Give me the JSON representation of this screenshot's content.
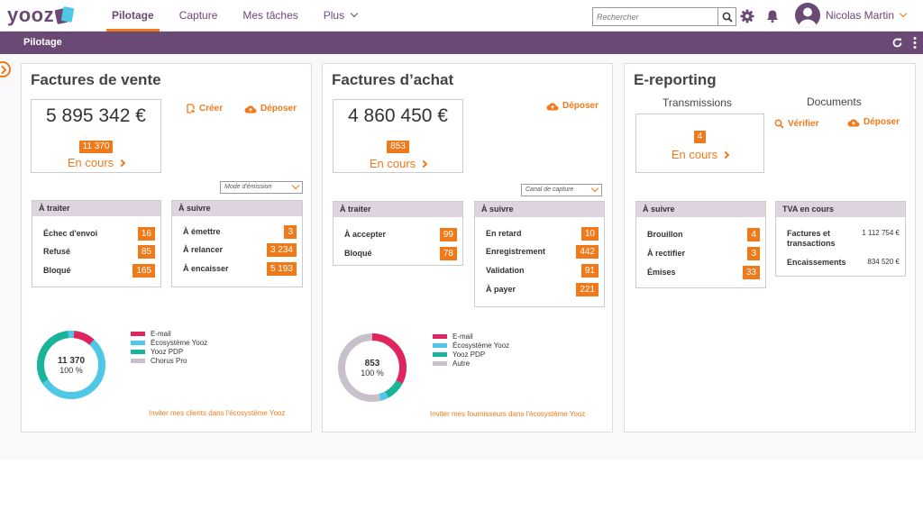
{
  "app": {
    "logo": "yooz"
  },
  "nav": {
    "items": [
      {
        "label": "Pilotage"
      },
      {
        "label": "Capture"
      },
      {
        "label": "Mes tâches"
      },
      {
        "label": "Plus"
      }
    ]
  },
  "search": {
    "placeholder": "Rechercher"
  },
  "user": {
    "name": "Nicolas Martin"
  },
  "subbar": {
    "title": "Pilotage"
  },
  "colors": {
    "brand": "#6a4a74",
    "accent": "#f07a1a",
    "email": "#e0245e",
    "ecosystem": "#4fc8e8",
    "pdp": "#18b59a",
    "other": "#c8c0ca"
  },
  "vente": {
    "title": "Factures de vente",
    "amount": "5 895 342 €",
    "count": "11 370",
    "link": "En cours",
    "create": "Créer",
    "deposit": "Déposer",
    "select": "Mode d'émission",
    "traiter": {
      "title": "À traiter",
      "rows": [
        {
          "label": "Échec d'envoi",
          "value": "16"
        },
        {
          "label": "Refusé",
          "value": "85"
        },
        {
          "label": "Bloqué",
          "value": "165"
        }
      ]
    },
    "suivre": {
      "title": "À suivre",
      "rows": [
        {
          "label": "À émettre",
          "value": "3"
        },
        {
          "label": "À relancer",
          "value": "3 234"
        },
        {
          "label": "À encaisser",
          "value": "5 193"
        }
      ]
    },
    "donut": {
      "total": "11 370",
      "percent": "100 %"
    },
    "legend": [
      "E-mail",
      "Écosystème Yooz",
      "Yooz PDP",
      "Chorus Pro"
    ],
    "invite": "Inviter mes clients dans l'écosystème Yooz"
  },
  "achat": {
    "title": "Factures d’achat",
    "amount": "4 860 450 €",
    "count": "853",
    "link": "En cours",
    "deposit": "Déposer",
    "select": "Canal de capture",
    "traiter": {
      "title": "À traiter",
      "rows": [
        {
          "label": "À accepter",
          "value": "99"
        },
        {
          "label": "Bloqué",
          "value": "78"
        }
      ]
    },
    "suivre": {
      "title": "À suivre",
      "rows": [
        {
          "label": "En retard",
          "value": "10"
        },
        {
          "label": "Enregistrement",
          "value": "442"
        },
        {
          "label": "Validation",
          "value": "91"
        },
        {
          "label": "À payer",
          "value": "221"
        }
      ]
    },
    "donut": {
      "total": "853",
      "percent": "100 %"
    },
    "legend": [
      "E-mail",
      "Écosystème Yooz",
      "Yooz PDP",
      "Autre"
    ],
    "invite": "Inviter mes fournisseurs dans l'écosystème Yooz"
  },
  "ereporting": {
    "title": "E-reporting",
    "transmissions": "Transmissions",
    "documents": "Documents",
    "count": "4",
    "link": "En cours",
    "verify": "Vérifier",
    "deposit": "Déposer",
    "suivre": {
      "title": "À suivre",
      "rows": [
        {
          "label": "Brouillon",
          "value": "4"
        },
        {
          "label": "À rectifier",
          "value": "3"
        },
        {
          "label": "Émises",
          "value": "33"
        }
      ]
    },
    "tva": {
      "title": "TVA en cours",
      "rows": [
        {
          "label": "Factures et transactions",
          "value": "1 112 754 €"
        },
        {
          "label": "Encaissements",
          "value": "834 520 €"
        }
      ]
    }
  }
}
